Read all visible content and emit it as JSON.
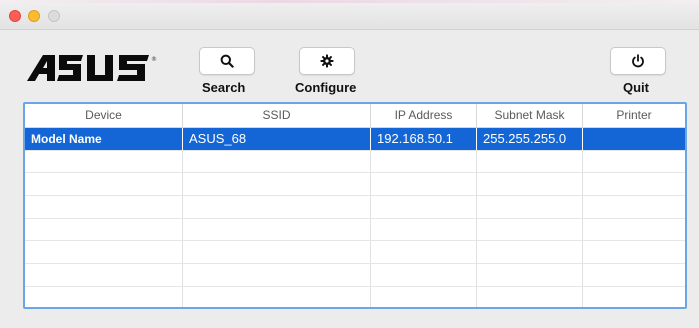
{
  "window": {
    "colors": {
      "close": "#fc5f57",
      "minimize": "#fdbc2e",
      "zoom": "#dcdcdc",
      "selection": "#1466d6",
      "table_focus_border": "#6aa6e6"
    }
  },
  "brand": {
    "logo_text": "ASUS",
    "trademark": "®"
  },
  "toolbar": {
    "search_label": "Search",
    "search_icon": "magnifier-icon",
    "configure_label": "Configure",
    "configure_icon": "gear-icon",
    "quit_label": "Quit",
    "quit_icon": "power-icon"
  },
  "table": {
    "columns": [
      "Device",
      "SSID",
      "IP Address",
      "Subnet Mask",
      "Printer"
    ],
    "rows": [
      {
        "device": "Model Name",
        "ssid": "ASUS_68",
        "ip": "192.168.50.1",
        "subnet": "255.255.255.0",
        "printer": "",
        "selected": true
      },
      {
        "device": "",
        "ssid": "",
        "ip": "",
        "subnet": "",
        "printer": ""
      },
      {
        "device": "",
        "ssid": "",
        "ip": "",
        "subnet": "",
        "printer": ""
      },
      {
        "device": "",
        "ssid": "",
        "ip": "",
        "subnet": "",
        "printer": ""
      },
      {
        "device": "",
        "ssid": "",
        "ip": "",
        "subnet": "",
        "printer": ""
      },
      {
        "device": "",
        "ssid": "",
        "ip": "",
        "subnet": "",
        "printer": ""
      },
      {
        "device": "",
        "ssid": "",
        "ip": "",
        "subnet": "",
        "printer": ""
      },
      {
        "device": "",
        "ssid": "",
        "ip": "",
        "subnet": "",
        "printer": ""
      }
    ]
  }
}
